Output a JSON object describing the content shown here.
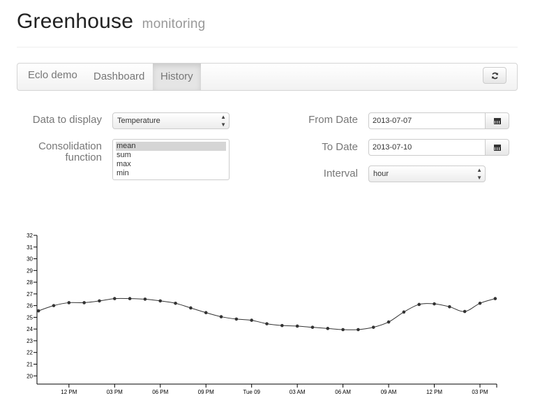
{
  "header": {
    "title": "Greenhouse",
    "subtitle": "monitoring"
  },
  "navbar": {
    "brand": "Eclo demo",
    "tabs": [
      {
        "label": "Dashboard",
        "active": false
      },
      {
        "label": "History",
        "active": true
      }
    ],
    "refresh_icon": "refresh-icon"
  },
  "form": {
    "data_to_display": {
      "label": "Data to display",
      "value": "Temperature"
    },
    "consolidation": {
      "label_line1": "Consolidation",
      "label_line2": "function",
      "options": [
        "mean",
        "sum",
        "max",
        "min"
      ],
      "selected": "mean"
    },
    "from_date": {
      "label": "From Date",
      "value": "2013-07-07",
      "icon": "calendar-icon"
    },
    "to_date": {
      "label": "To Date",
      "value": "2013-07-10",
      "icon": "calendar-icon"
    },
    "interval": {
      "label": "Interval",
      "value": "hour"
    }
  },
  "chart_data": {
    "type": "line",
    "title": "",
    "xlabel": "",
    "ylabel": "",
    "ylim": [
      19.3,
      32
    ],
    "y_ticks": [
      20,
      21,
      22,
      23,
      24,
      25,
      26,
      27,
      28,
      29,
      30,
      31,
      32
    ],
    "x_ticks": [
      {
        "label": "12 PM",
        "x": 2
      },
      {
        "label": "03 PM",
        "x": 5
      },
      {
        "label": "06 PM",
        "x": 8
      },
      {
        "label": "09 PM",
        "x": 11
      },
      {
        "label": "Tue 09",
        "x": 14
      },
      {
        "label": "03 AM",
        "x": 17
      },
      {
        "label": "06 AM",
        "x": 20
      },
      {
        "label": "09 AM",
        "x": 23
      },
      {
        "label": "12 PM",
        "x": 26
      },
      {
        "label": "03 PM",
        "x": 29
      }
    ],
    "xlim": [
      -0.1,
      30.1
    ],
    "series": [
      {
        "color": "#333333",
        "x": [
          0,
          1,
          2,
          3,
          4,
          5,
          6,
          7,
          8,
          9,
          10,
          11,
          12,
          13,
          14,
          15,
          16,
          17,
          18,
          19,
          20,
          21,
          22,
          23,
          24,
          25,
          26,
          27,
          28,
          29,
          30
        ],
        "values": [
          25.55,
          26.0,
          26.25,
          26.25,
          26.4,
          26.6,
          26.6,
          26.55,
          26.4,
          26.2,
          25.8,
          25.4,
          25.05,
          24.85,
          24.75,
          24.45,
          24.3,
          24.25,
          24.15,
          24.05,
          23.95,
          23.95,
          24.15,
          24.6,
          25.45,
          26.1,
          26.15,
          25.9,
          25.5,
          26.2,
          26.6
        ]
      }
    ]
  }
}
